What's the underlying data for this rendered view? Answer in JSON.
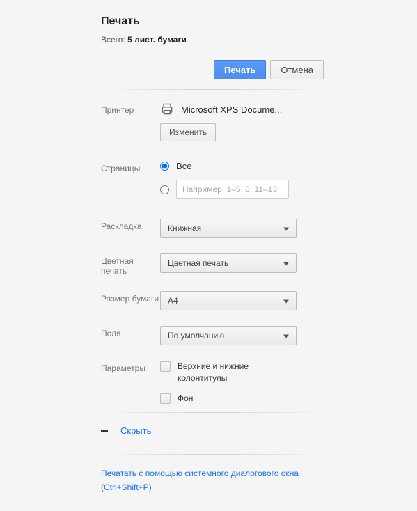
{
  "title": "Печать",
  "summary": {
    "label": "Всего: ",
    "value": "5 лист. бумаги"
  },
  "actions": {
    "print": "Печать",
    "cancel": "Отмена"
  },
  "printer": {
    "label": "Принтер",
    "name": "Microsoft XPS Docume...",
    "change": "Изменить"
  },
  "pages": {
    "label": "Страницы",
    "all": "Все",
    "range_placeholder": "Например: 1–5, 8, 11–13"
  },
  "layout": {
    "label": "Раскладка",
    "value": "Книжная"
  },
  "color": {
    "label": "Цветная печать",
    "value": "Цветная печать"
  },
  "paper": {
    "label": "Размер бумаги",
    "value": "A4"
  },
  "margins": {
    "label": "Поля",
    "value": "По умолчанию"
  },
  "options": {
    "label": "Параметры",
    "headers_footers": "Верхние и нижние колонтитулы",
    "background": "Фон"
  },
  "collapse": {
    "label": "Скрыть"
  },
  "system_print": "Печатать с помощью системного диалогового окна (Ctrl+Shift+P)"
}
